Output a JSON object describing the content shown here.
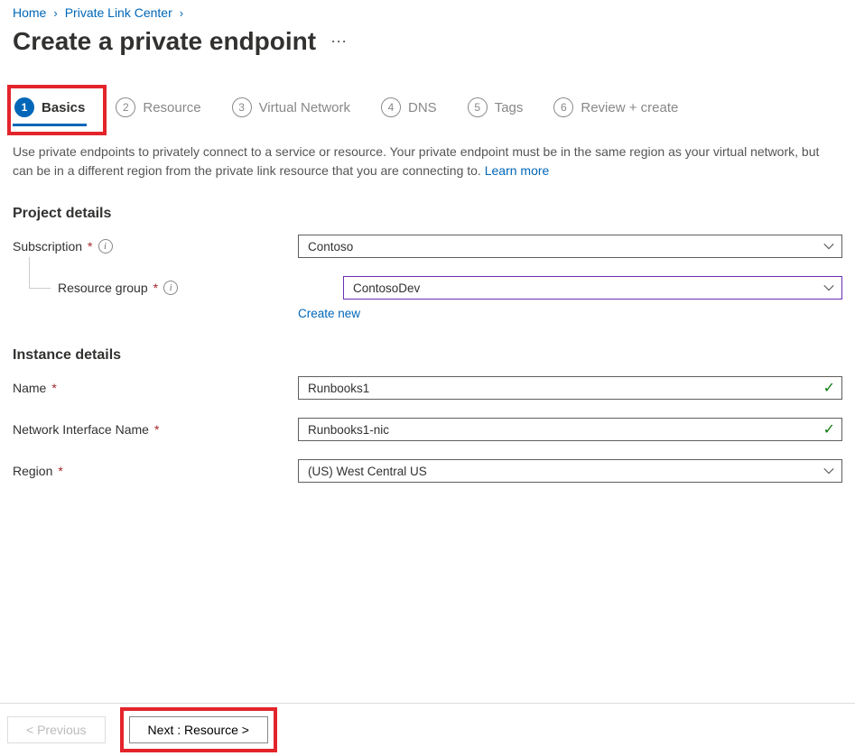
{
  "breadcrumb": {
    "home": "Home",
    "center": "Private Link Center"
  },
  "title": "Create a private endpoint",
  "tabs": [
    {
      "num": "1",
      "label": "Basics"
    },
    {
      "num": "2",
      "label": "Resource"
    },
    {
      "num": "3",
      "label": "Virtual Network"
    },
    {
      "num": "4",
      "label": "DNS"
    },
    {
      "num": "5",
      "label": "Tags"
    },
    {
      "num": "6",
      "label": "Review + create"
    }
  ],
  "description": "Use private endpoints to privately connect to a service or resource. Your private endpoint must be in the same region as your virtual network, but can be in a different region from the private link resource that you are connecting to.  ",
  "learn_more": "Learn more",
  "sections": {
    "project": "Project details",
    "instance": "Instance details"
  },
  "fields": {
    "subscription": {
      "label": "Subscription",
      "value": "Contoso"
    },
    "resource_group": {
      "label": "Resource group",
      "value": "ContosoDev",
      "create_new": "Create new"
    },
    "name": {
      "label": "Name",
      "value": "Runbooks1"
    },
    "nic": {
      "label": "Network Interface Name",
      "value": "Runbooks1-nic"
    },
    "region": {
      "label": "Region",
      "value": "(US) West Central US"
    }
  },
  "footer": {
    "prev": "< Previous",
    "next": "Next : Resource >"
  }
}
